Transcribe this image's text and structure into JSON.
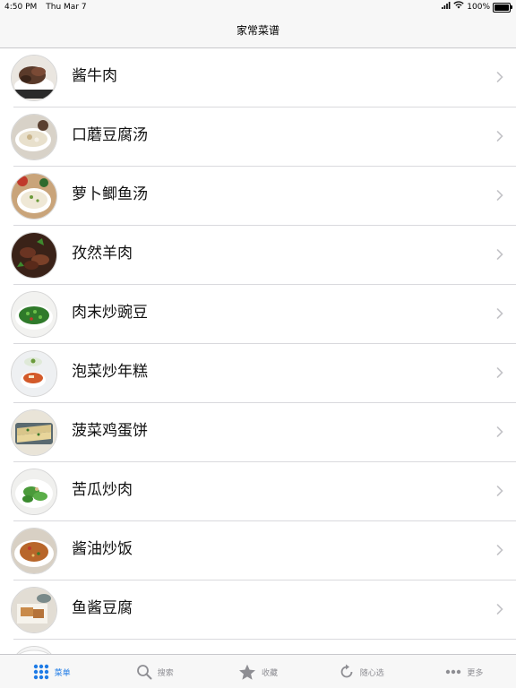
{
  "status_bar": {
    "time": "4:50 PM",
    "date": "Thu Mar 7",
    "battery": "100%",
    "battery_level": 1.0
  },
  "nav": {
    "title": "家常菜谱"
  },
  "recipes": [
    {
      "name": "酱牛肉"
    },
    {
      "name": "口蘑豆腐汤"
    },
    {
      "name": "萝卜鲫鱼汤"
    },
    {
      "name": "孜然羊肉"
    },
    {
      "name": "肉末炒豌豆"
    },
    {
      "name": "泡菜炒年糕"
    },
    {
      "name": "菠菜鸡蛋饼"
    },
    {
      "name": "苦瓜炒肉"
    },
    {
      "name": "酱油炒饭"
    },
    {
      "name": "鱼酱豆腐"
    }
  ],
  "tab_bar": {
    "tabs": [
      {
        "label": "菜单",
        "icon": "grid-icon",
        "active": true
      },
      {
        "label": "搜索",
        "icon": "search-icon",
        "active": false
      },
      {
        "label": "收藏",
        "icon": "star-icon",
        "active": false
      },
      {
        "label": "随心选",
        "icon": "refresh-icon",
        "active": false
      },
      {
        "label": "更多",
        "icon": "more-icon",
        "active": false
      }
    ]
  },
  "colors": {
    "accent": "#1e7be6",
    "inactive": "#8e8e93",
    "bar_background": "#f7f7f7"
  }
}
